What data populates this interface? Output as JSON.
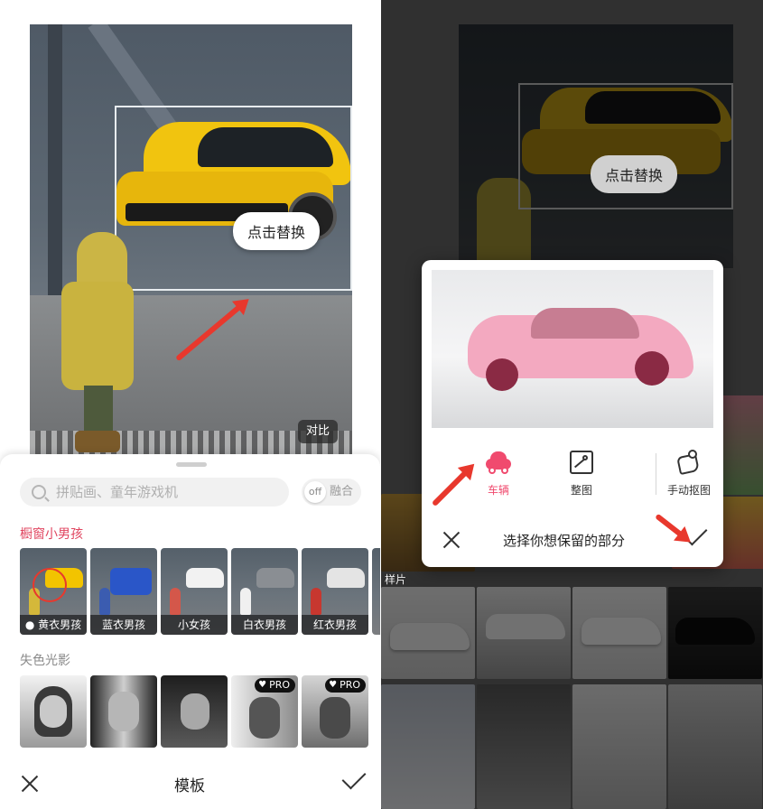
{
  "left": {
    "canvas": {
      "replace_label": "点击替换",
      "contrast_label": "对比"
    },
    "search": {
      "placeholder": "拼贴画、童年游戏机"
    },
    "fuse_toggle": {
      "state_label": "off",
      "label": "融合"
    },
    "section1": {
      "title": "橱窗小男孩",
      "items": [
        {
          "label": "黄衣男孩",
          "car": "#f2c400",
          "kid": "#d4b83a"
        },
        {
          "label": "蓝衣男孩",
          "car": "#2a56c8",
          "kid": "#3b5cb0"
        },
        {
          "label": "小女孩",
          "car": "#f2f2f2",
          "kid": "#d4574a"
        },
        {
          "label": "白衣男孩",
          "car": "#8a8e93",
          "kid": "#f0f0f0"
        },
        {
          "label": "红衣男孩",
          "car": "#e4e4e4",
          "kid": "#c7372f"
        }
      ]
    },
    "section2": {
      "title": "失色光影",
      "pro_label": "PRO"
    },
    "bottom_bar": {
      "title": "模板"
    }
  },
  "right": {
    "canvas": {
      "replace_label": "点击替换"
    },
    "sample_label": "样片",
    "dialog": {
      "tools": [
        {
          "label": "车辆",
          "icon": "car-icon"
        },
        {
          "label": "整图",
          "icon": "image-icon"
        },
        {
          "label": "手动抠图",
          "icon": "puzzle-icon"
        }
      ],
      "prompt": "选择你想保留的部分"
    }
  },
  "colors": {
    "accent_pink": "#f04a6e",
    "accent_red": "#e04a3f",
    "arrow_red": "#e8382d"
  }
}
